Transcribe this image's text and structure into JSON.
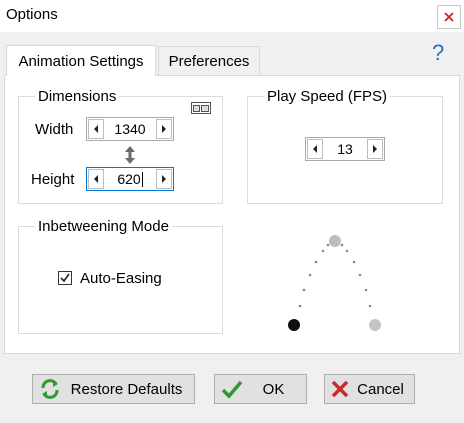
{
  "window": {
    "title": "Options",
    "close_icon": "close-icon"
  },
  "tabs": [
    {
      "label": "Animation Settings",
      "active": true
    },
    {
      "label": "Preferences",
      "active": false
    }
  ],
  "help": {
    "icon": "question-mark-icon",
    "glyph": "?"
  },
  "dimensions": {
    "label": "Dimensions",
    "width_label": "Width",
    "width_value": "1340",
    "height_label": "Height",
    "height_value": "620",
    "link_icon": "aspect-ratio-icon",
    "swap_icon": "vertical-resize-arrows-icon"
  },
  "play_speed": {
    "label": "Play Speed (FPS)",
    "value": "13"
  },
  "inbetweening": {
    "label": "Inbetweening Mode",
    "auto_easing_label": "Auto-Easing",
    "auto_easing_checked": true
  },
  "preview": {
    "icon": "easing-arc-preview"
  },
  "buttons": {
    "restore_label": "Restore Defaults",
    "ok_label": "OK",
    "cancel_label": "Cancel"
  },
  "colors": {
    "accent": "#0078d7",
    "help": "#2c6fc2",
    "ok_check": "#2e9a2e",
    "cancel_x": "#cc2a2a",
    "close_x": "#c42b1c",
    "restore_green": "#2d9b2d"
  }
}
